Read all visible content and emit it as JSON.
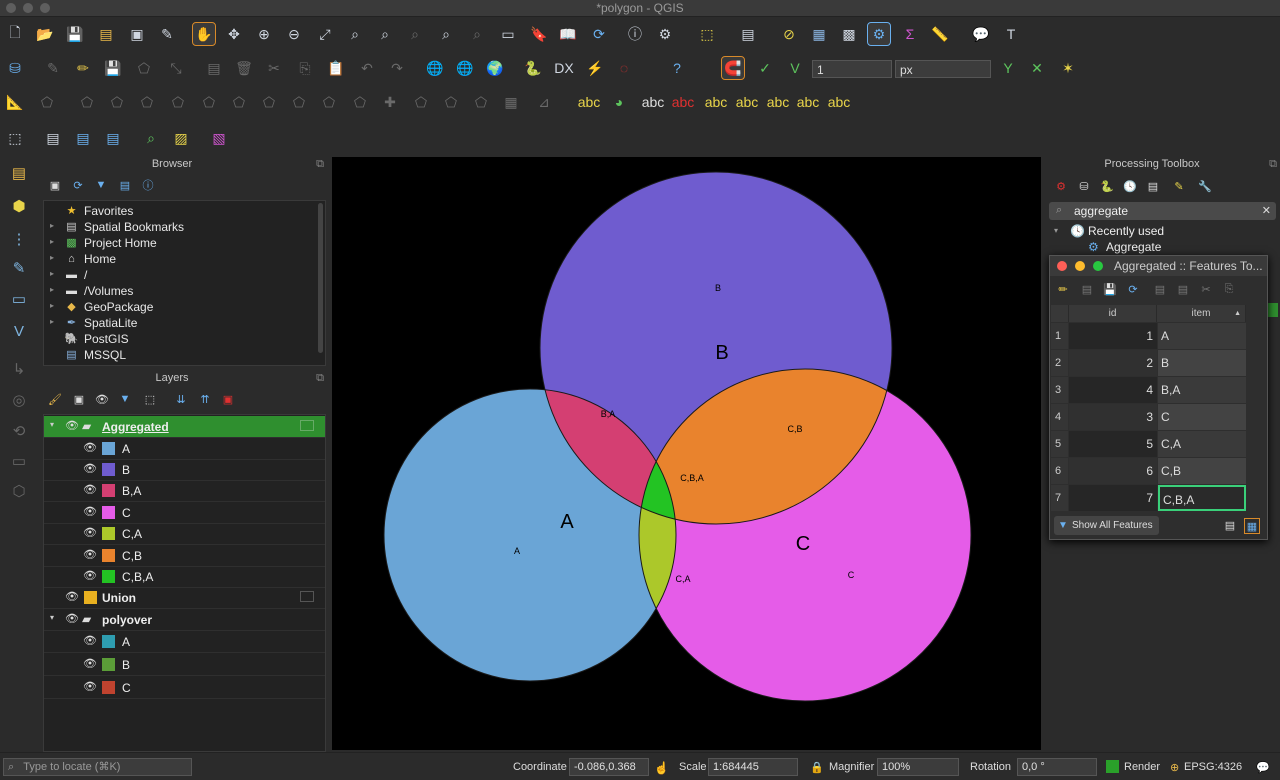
{
  "window": {
    "title": "*polygon - QGIS"
  },
  "toolbar_options": {
    "snap_tolerance": "1",
    "units": "px"
  },
  "browser": {
    "title": "Browser",
    "items": [
      {
        "label": "Favorites",
        "icon": "star-icon"
      },
      {
        "label": "Spatial Bookmarks",
        "icon": "bookmark-icon"
      },
      {
        "label": "Project Home",
        "icon": "project-home-icon"
      },
      {
        "label": "Home",
        "icon": "home-icon"
      },
      {
        "label": "/",
        "icon": "folder-icon"
      },
      {
        "label": "/Volumes",
        "icon": "folder-icon"
      },
      {
        "label": "GeoPackage",
        "icon": "geopackage-icon"
      },
      {
        "label": "SpatiaLite",
        "icon": "spatialite-icon"
      },
      {
        "label": "PostGIS",
        "icon": "postgis-icon"
      },
      {
        "label": "MSSQL",
        "icon": "mssql-icon"
      }
    ]
  },
  "layers": {
    "title": "Layers",
    "groups": [
      {
        "name": "Aggregated",
        "children": [
          {
            "label": "A",
            "color": "#6aa5d6"
          },
          {
            "label": "B",
            "color": "#6f5ccf"
          },
          {
            "label": "B,A",
            "color": "#d43f72"
          },
          {
            "label": "C",
            "color": "#e55ce8"
          },
          {
            "label": "C,A",
            "color": "#acc82a"
          },
          {
            "label": "C,B",
            "color": "#e9832d"
          },
          {
            "label": "C,B,A",
            "color": "#23c323"
          }
        ]
      },
      {
        "name": "Union",
        "color": "#e8b020"
      },
      {
        "name": "polyover",
        "children": [
          {
            "label": "A",
            "color": "#2e9db0"
          },
          {
            "label": "B",
            "color": "#5b9d38"
          },
          {
            "label": "C",
            "color": "#c0432f"
          }
        ]
      }
    ]
  },
  "map": {
    "big_labels": {
      "A": "A",
      "B": "B",
      "C": "C"
    },
    "small_labels": {
      "A": "A",
      "B": "B",
      "C": "C",
      "BA": "B,A",
      "CB": "C,B",
      "CA": "C,A",
      "CBA": "C,B,A"
    }
  },
  "processing": {
    "title": "Processing Toolbox",
    "search": "aggregate",
    "recently_used": "Recently used",
    "algorithm": "Aggregate"
  },
  "attr_table": {
    "title": "Aggregated :: Features To...",
    "columns": [
      "id",
      "item"
    ],
    "rows": [
      {
        "n": "1",
        "id": "1",
        "item": "A"
      },
      {
        "n": "2",
        "id": "2",
        "item": "B"
      },
      {
        "n": "3",
        "id": "4",
        "item": "B,A"
      },
      {
        "n": "4",
        "id": "3",
        "item": "C"
      },
      {
        "n": "5",
        "id": "5",
        "item": "C,A"
      },
      {
        "n": "6",
        "id": "6",
        "item": "C,B"
      },
      {
        "n": "7",
        "id": "7",
        "item": "C,B,A"
      }
    ],
    "filter_label": "Show All Features"
  },
  "statusbar": {
    "locate_placeholder": "Type to locate (⌘K)",
    "coordinate_label": "Coordinate",
    "coordinate": "-0.086,0.368",
    "scale_label": "Scale",
    "scale": "1:684445",
    "magnifier_label": "Magnifier",
    "magnifier": "100%",
    "rotation_label": "Rotation",
    "rotation": "0,0 °",
    "render_label": "Render",
    "crs": "EPSG:4326"
  }
}
